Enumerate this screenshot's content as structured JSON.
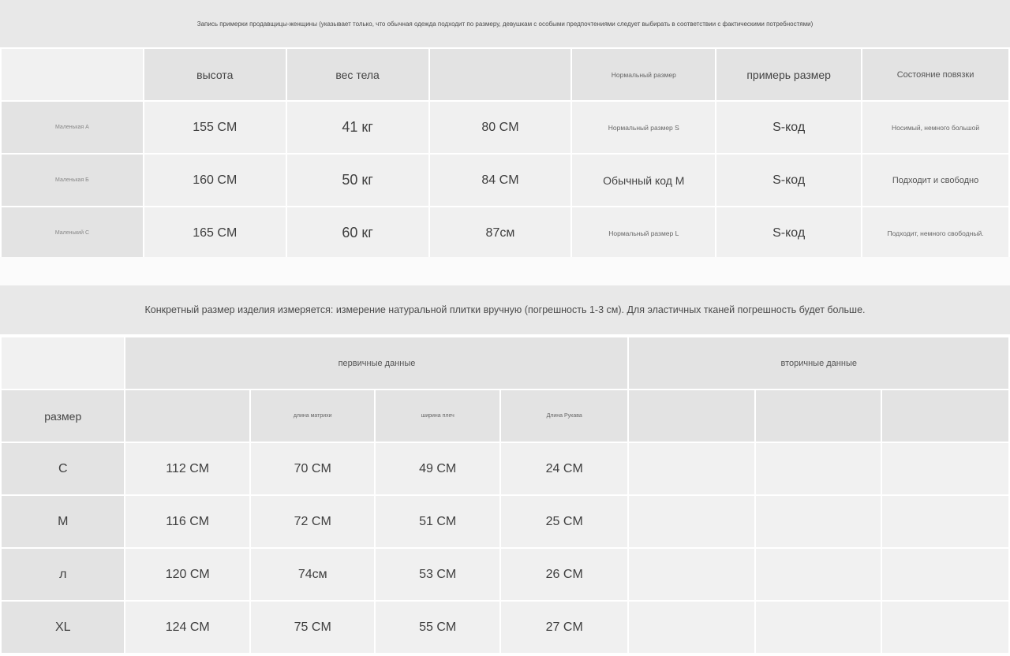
{
  "fit_note": "Запись примерки продавщицы-женщины (указывает только, что обычная одежда подходит по размеру, девушкам с особыми предпочтениями следует выбирать в соответствии с фактическими потребностями)",
  "fit_table": {
    "headers": [
      "высота",
      "вес тела",
      "Нормальный размер",
      "примерь размер",
      "Состояние повязки"
    ],
    "rows": [
      {
        "name": "Маленькая А",
        "height": "155 CM",
        "weight": "41 кг",
        "bust": "80 CM",
        "normal": "Нормальный размер S",
        "tried": "S-код",
        "state": "Носимый, немного большой"
      },
      {
        "name": "Маленькая Б",
        "height": "160 CM",
        "weight": "50 кг",
        "bust": "84 CM",
        "normal": "Обычный код M",
        "tried": "S-код",
        "state": "Подходит и свободно"
      },
      {
        "name": "Маленький С",
        "height": "165 CM",
        "weight": "60 кг",
        "bust": "87см",
        "normal": "Нормальный размер L",
        "tried": "S-код",
        "state": "Подходит, немного свободный."
      }
    ]
  },
  "measure_note": "Конкретный размер изделия измеряется: измерение натуральной плитки вручную (погрешность 1-3 см). Для эластичных тканей погрешность будет больше.",
  "size_table": {
    "primary_label": "первичные данные",
    "secondary_label": "вторичные данные",
    "size_label": "размер",
    "columns": [
      "длина матрихи",
      "ширина плеч",
      "Длина Рукава"
    ],
    "rows": [
      {
        "size": "С",
        "bust": "112 CM",
        "length": "70 CM",
        "shoulder": "49 CM",
        "sleeve": "24 CM"
      },
      {
        "size": "М",
        "bust": "116 CM",
        "length": "72 CM",
        "shoulder": "51 CM",
        "sleeve": "25 CM"
      },
      {
        "size": "л",
        "bust": "120 CM",
        "length": "74см",
        "shoulder": "53 CM",
        "sleeve": "26 CM"
      },
      {
        "size": "XL",
        "bust": "124 CM",
        "length": "75 CM",
        "shoulder": "55 CM",
        "sleeve": "27 CM"
      }
    ]
  }
}
